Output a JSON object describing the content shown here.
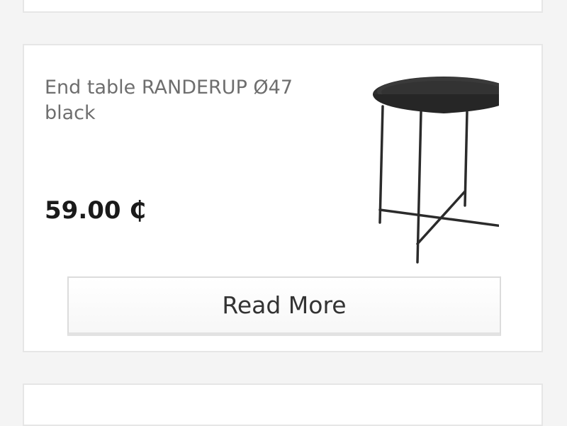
{
  "product": {
    "title": "End table RANDERUP Ø47 black",
    "price": "59.00 ₵",
    "image_alt": "end-table-image",
    "read_more_label": "Read More"
  }
}
